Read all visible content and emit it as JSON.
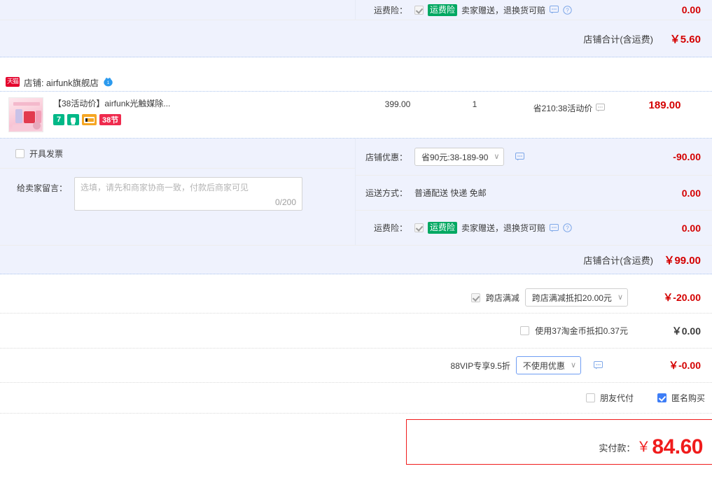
{
  "top_store_block": {
    "insurance_row": {
      "label": "运费险：",
      "checked": true,
      "pill": "运费险",
      "text": "卖家赠送，退换货可赔",
      "amount": "0.00"
    },
    "store_total": {
      "label": "店铺合计(含运费)",
      "amount": "￥5.60"
    }
  },
  "store": {
    "tmall_badge": "天猫",
    "name": "店铺: airfunk旗舰店",
    "chat_icon": "wangwang-icon"
  },
  "product": {
    "title": "【38活动价】airfunk光触媒除...",
    "tags": [
      "7",
      "lamp-icon",
      "card-icon",
      "38节"
    ],
    "unit_price": "399.00",
    "quantity": "1",
    "promo_note": "省210:38活动价",
    "subtotal": "189.00"
  },
  "left_pane": {
    "invoice_label": "开具发票",
    "invoice_checked": false,
    "message_label": "给卖家留言：",
    "message_placeholder": "选填，请先和商家协商一致，付款后商家可见",
    "message_value": "",
    "message_counter": "0/200"
  },
  "right_pane": {
    "shop_discount": {
      "label": "店铺优惠：",
      "selected": "省90元:38-189-90",
      "amount": "-90.00"
    },
    "shipping": {
      "label": "运送方式：",
      "text": "普通配送 快递 免邮",
      "amount": "0.00"
    },
    "insurance": {
      "label": "运费险：",
      "checked": true,
      "pill": "运费险",
      "text": "卖家赠送，退换货可赔",
      "amount": "0.00"
    },
    "store_total": {
      "label": "店铺合计(含运费)",
      "amount": "￥99.00"
    }
  },
  "promotions": {
    "cross_store": {
      "checked": true,
      "label": "跨店满减",
      "selected": "跨店满减抵扣20.00元",
      "amount": "￥-20.00"
    },
    "coin": {
      "checked": false,
      "label": "使用37淘金币抵扣0.37元",
      "amount": "￥0.00"
    },
    "vip": {
      "label": "88VIP专享9.5折",
      "selected": "不使用优惠",
      "amount": "￥-0.00"
    },
    "options": {
      "friend_pay": {
        "label": "朋友代付",
        "checked": false
      },
      "anonymous": {
        "label": "匿名购买",
        "checked": true
      }
    }
  },
  "final_total": {
    "label": "实付款：",
    "currency": "￥",
    "amount": "84.60"
  },
  "colors": {
    "accent_red": "#d40000",
    "total_red": "#f01c1c",
    "tmall_red": "#e4002b",
    "insurance_green": "#00a862",
    "checkbox_blue": "#3d7df6",
    "pane_blue": "#eff2fd"
  }
}
